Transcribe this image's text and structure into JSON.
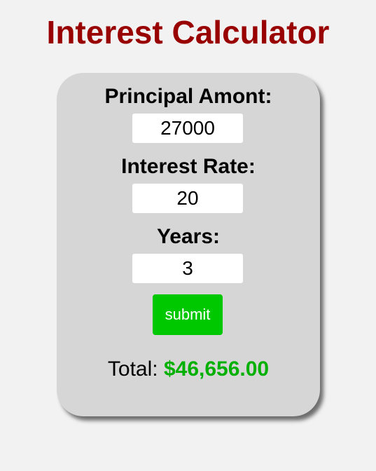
{
  "page": {
    "title": "Interest Calculator"
  },
  "form": {
    "principal_label": "Principal Amont:",
    "principal_value": "27000",
    "rate_label": "Interest Rate:",
    "rate_value": "20",
    "years_label": "Years:",
    "years_value": "3",
    "submit_label": "submit"
  },
  "result": {
    "total_label": "Total:",
    "total_value": "$46,656.00"
  },
  "colors": {
    "title": "#990000",
    "background": "#f2f2f2",
    "card": "#d6d6d6",
    "button": "#00c800",
    "total_value": "#00b000"
  }
}
